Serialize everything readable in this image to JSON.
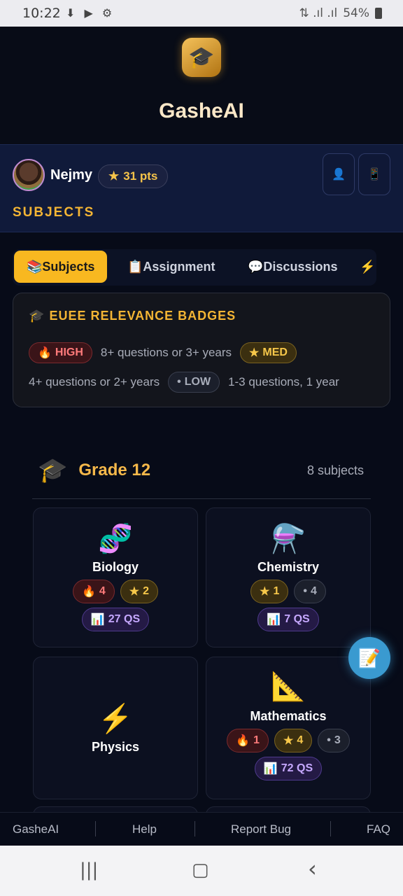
{
  "status": {
    "time": "10:22",
    "icons": "⬇ ▶ ⚙",
    "signal": "⇅ .ıl .ıl",
    "battery": "54%"
  },
  "brand": {
    "logo_icon": "graduation-cap",
    "title": "GasheAI"
  },
  "user": {
    "name": "Nejmy",
    "points": "31 pts",
    "points_icon": "★",
    "profile_icon": "👤",
    "device_icon": "📱"
  },
  "section_label": "SUBJECTS",
  "tabs": [
    {
      "icon": "📚",
      "label": "Subjects"
    },
    {
      "icon": "📋",
      "label": "Assignment"
    },
    {
      "icon": "💬",
      "label": "Discussions"
    },
    {
      "icon": "⚡",
      "label": ""
    }
  ],
  "badges": {
    "icon": "🎓",
    "title": "EUEE RELEVANCE BADGES",
    "high_icon": "🔥",
    "high": "HIGH",
    "high_desc": "8+ questions or 3+ years",
    "med_icon": "★",
    "med": "MED",
    "med_desc": "4+ questions or 2+ years",
    "low_icon": "•",
    "low": "LOW",
    "low_desc": "1-3 questions, 1 year"
  },
  "grade": {
    "icon": "🎓",
    "title": "Grade 12",
    "count": "8 subjects"
  },
  "subjects": [
    {
      "icon": "🧬",
      "name": "Biology",
      "high": "4",
      "med": "2",
      "low": "",
      "qs": "27 QS"
    },
    {
      "icon": "⚗️",
      "name": "Chemistry",
      "high": "",
      "med": "1",
      "low": "4",
      "qs": "7 QS"
    },
    {
      "icon": "⚡",
      "name": "Physics",
      "high": "",
      "med": "",
      "low": "",
      "qs": ""
    },
    {
      "icon": "📐",
      "name": "Mathematics",
      "high": "1",
      "med": "4",
      "low": "3",
      "qs": "72 QS"
    }
  ],
  "fab_icon": "📝",
  "footer": [
    "GasheAI",
    "Help",
    "Report Bug",
    "FAQ"
  ],
  "navbar": {
    "recents": "|||",
    "home": "▢",
    "back": "‹"
  }
}
